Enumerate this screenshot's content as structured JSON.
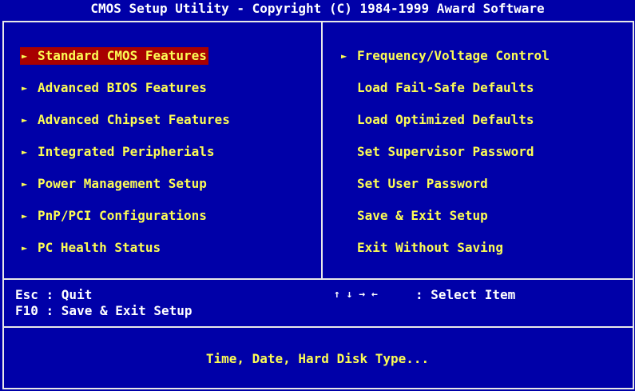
{
  "title": "CMOS Setup Utility - Copyright (C) 1984-1999 Award Software",
  "arrow_glyph": "►",
  "left_menu": [
    {
      "label": "Standard CMOS Features",
      "submenu": true,
      "selected": true
    },
    {
      "label": "Advanced BIOS Features",
      "submenu": true
    },
    {
      "label": "Advanced Chipset Features",
      "submenu": true
    },
    {
      "label": "Integrated Peripherials",
      "submenu": true
    },
    {
      "label": "Power Management Setup",
      "submenu": true
    },
    {
      "label": "PnP/PCI Configurations",
      "submenu": true
    },
    {
      "label": "PC Health Status",
      "submenu": true
    }
  ],
  "right_menu": [
    {
      "label": "Frequency/Voltage Control",
      "submenu": true
    },
    {
      "label": "Load Fail-Safe Defaults",
      "submenu": false
    },
    {
      "label": "Load Optimized Defaults",
      "submenu": false
    },
    {
      "label": "Set Supervisor Password",
      "submenu": false
    },
    {
      "label": "Set User Password",
      "submenu": false
    },
    {
      "label": "Save & Exit Setup",
      "submenu": false
    },
    {
      "label": "Exit Without Saving",
      "submenu": false
    }
  ],
  "keys": {
    "esc": "Esc : Quit",
    "f10": "F10 : Save & Exit Setup",
    "arrows": "↑ ↓ → ←",
    "select": ": Select Item"
  },
  "help_text": "Time, Date, Hard Disk Type...",
  "colors": {
    "background": "#0000a8",
    "text": "#fcfc54",
    "highlight": "#a80000",
    "border": "#e8e8e8",
    "title_text": "#ffffff"
  }
}
